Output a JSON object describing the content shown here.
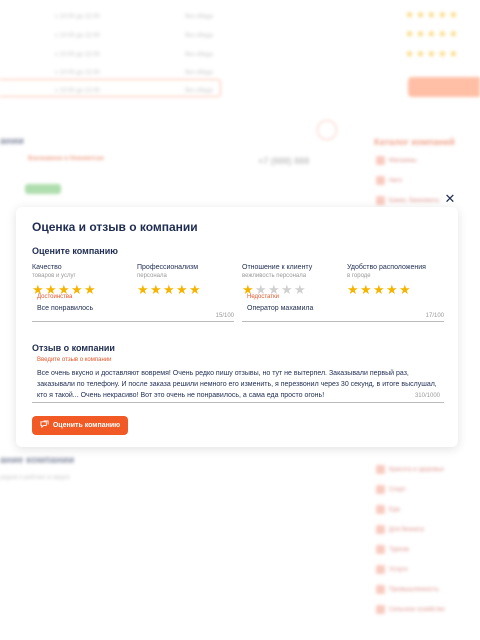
{
  "modal": {
    "title": "Оценка и отзыв о компании",
    "rate_heading": "Оцените компанию",
    "criteria": [
      {
        "name": "Качество",
        "desc": "товаров и услуг",
        "stars": 5
      },
      {
        "name": "Профессионализм",
        "desc": "персонала",
        "stars": 5
      },
      {
        "name": "Отношение к клиенту",
        "desc": "вежливость персонала",
        "stars": 1
      },
      {
        "name": "Удобство расположения",
        "desc": "в городе",
        "stars": 5
      }
    ],
    "pros": {
      "label": "Достоинства",
      "value": "Все понравилось",
      "counter": "15/100"
    },
    "cons": {
      "label": "Недостатки",
      "value": "Оператор махамила",
      "counter": "17/100"
    },
    "review_heading": "Отзыв о компании",
    "review": {
      "label": "Введите отзыв о компании",
      "value": "Все очень вкусно и доставляют вовремя! Очень редко пишу отзывы, но тут не вытерпел. Заказывали первый раз, заказывали по телефону. И после заказа решили немного его изменить, я перезвонил через 30 секунд, в итоге выслушал, кто я такой... Очень некрасиво! Вот это очень не понравилось, а сама еда просто огонь!",
      "counter": "310/1000"
    },
    "submit_label": "Оценить компанию",
    "close_glyph": "✕",
    "star_glyph": "★"
  },
  "background": {
    "rows": [
      {
        "time": "с 10:00 до 22:00",
        "lunch": "без обеда"
      },
      {
        "time": "с 10:00 до 22:00",
        "lunch": "без обеда"
      },
      {
        "time": "с 10:00 до 22:00",
        "lunch": "без обеда"
      },
      {
        "time": "с 10:00 до 22:00",
        "lunch": "без обеда"
      },
      {
        "time": "с 10:00 до 22:00",
        "lunch": "без обеда"
      }
    ],
    "company_name": "Взонкавене в Новояктске",
    "phone": "+7 (888) 888",
    "section_companies": "ании",
    "catalog_title": "Каталог компаний",
    "catalog_items": [
      "Магазины",
      "Авто",
      "Банки, банкоматы",
      "Красота и здоровье",
      "Спорт",
      "Еда",
      "Для бизнеса",
      "Туризм",
      "Услуги",
      "Промышленность",
      "Сельское хозяйство"
    ],
    "nearby_title": "ание компании",
    "nearby_desc": "рядом и рейтинг в округе"
  },
  "colors": {
    "accent": "#f15a24",
    "star": "#f5b400",
    "star_off": "#d0d0d0",
    "text": "#1f2d52"
  }
}
